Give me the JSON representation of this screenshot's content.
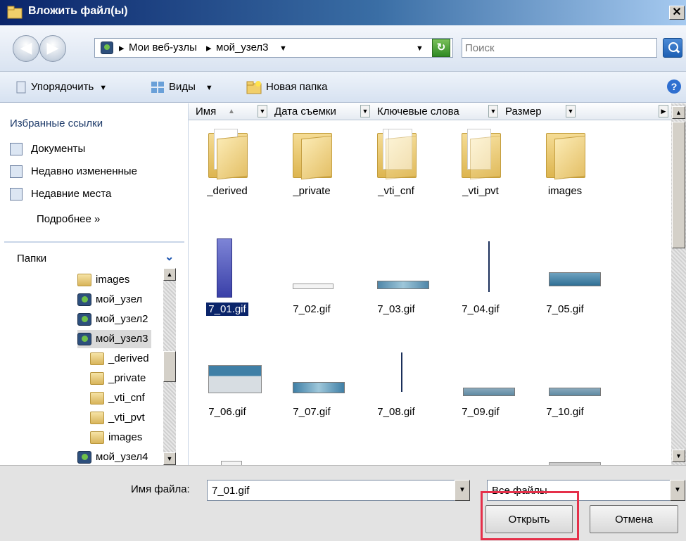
{
  "window": {
    "title": "Вложить файл(ы)",
    "close": "✕"
  },
  "nav": {
    "back_glyph": "◀",
    "forward_glyph": "▶",
    "breadcrumb": [
      "Мои веб-узлы",
      "мой_узел3"
    ],
    "search_placeholder": "Поиск"
  },
  "toolbar": {
    "organize": "Упорядочить",
    "views": "Виды",
    "new_folder": "Новая папка",
    "help": "?"
  },
  "favorites": {
    "title": "Избранные ссылки",
    "items": [
      {
        "label": "Документы",
        "icon": "documents-icon"
      },
      {
        "label": "Недавно измененные",
        "icon": "recent-changes-icon"
      },
      {
        "label": "Недавние места",
        "icon": "recent-places-icon"
      }
    ],
    "more": "Подробнее  »"
  },
  "folders": {
    "title": "Папки",
    "tree": [
      {
        "label": "images",
        "type": "folder"
      },
      {
        "label": "мой_узел",
        "type": "web"
      },
      {
        "label": "мой_узел2",
        "type": "web"
      },
      {
        "label": "мой_узел3",
        "type": "web",
        "selected": true
      },
      {
        "label": "_derived",
        "type": "folder"
      },
      {
        "label": "_private",
        "type": "folder"
      },
      {
        "label": "_vti_cnf",
        "type": "folder"
      },
      {
        "label": "_vti_pvt",
        "type": "folder"
      },
      {
        "label": "images",
        "type": "folder"
      },
      {
        "label": "мой_узел4",
        "type": "web"
      }
    ]
  },
  "columns": [
    "Имя",
    "Дата съемки",
    "Ключевые слова",
    "Размер"
  ],
  "files": [
    {
      "name": "_derived",
      "kind": "folder"
    },
    {
      "name": "_private",
      "kind": "folder"
    },
    {
      "name": "_vti_cnf",
      "kind": "folder"
    },
    {
      "name": "_vti_pvt",
      "kind": "folder"
    },
    {
      "name": "images",
      "kind": "folder"
    },
    {
      "name": "7_01.gif",
      "kind": "gif",
      "selected": true
    },
    {
      "name": "7_02.gif",
      "kind": "gif"
    },
    {
      "name": "7_03.gif",
      "kind": "gif"
    },
    {
      "name": "7_04.gif",
      "kind": "gif"
    },
    {
      "name": "7_05.gif",
      "kind": "gif"
    },
    {
      "name": "7_06.gif",
      "kind": "gif"
    },
    {
      "name": "7_07.gif",
      "kind": "gif"
    },
    {
      "name": "7_08.gif",
      "kind": "gif"
    },
    {
      "name": "7_09.gif",
      "kind": "gif"
    },
    {
      "name": "7_10.gif",
      "kind": "gif"
    }
  ],
  "bottom": {
    "filename_label": "Имя файла:",
    "filename_value": "7_01.gif",
    "filetype": "Все файлы",
    "open": "Открыть",
    "cancel": "Отмена"
  },
  "colors": {
    "highlight": "#e5304a",
    "selection": "#0a246a"
  }
}
